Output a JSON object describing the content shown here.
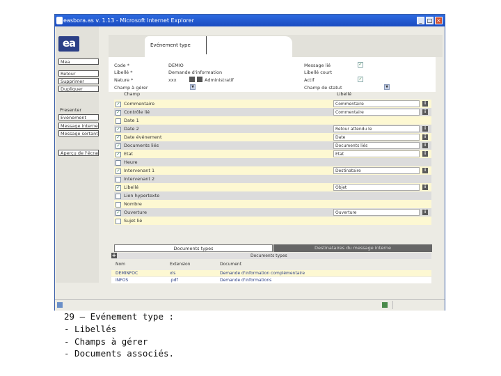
{
  "window": {
    "title": "easbora.as v. 1.13 - Microsoft Internet Explorer"
  },
  "sidebar": {
    "buttons_top": [
      "Mea",
      "Retour",
      "Supprimer",
      "Dupliquer"
    ],
    "section_label": "Presenter",
    "buttons_mid": [
      "Evénement",
      "Message interne",
      "Message sortant"
    ],
    "button_bottom": "Aperçu de l'écran"
  },
  "tab": {
    "label": "Evénement type"
  },
  "form": {
    "code_label": "Code *",
    "code_value": "DEMIO",
    "libelle_label": "Libellé *",
    "libelle_value": "Demande d'information",
    "nature_label": "Nature *",
    "nature_value": "xxx",
    "nature_extra": "Administratif",
    "champ_label": "Champ à gérer",
    "message_label": "Message lié",
    "message_checked": true,
    "libelle_court_label": "Libellé court",
    "actif_label": "Actif",
    "actif_checked": true,
    "champ_statut_label": "Champ de statut"
  },
  "grid": {
    "col_champ": "Champ",
    "col_libelle": "Libellé",
    "rows": [
      {
        "checked": true,
        "name": "Commentaire",
        "libelle": "Commentaire",
        "info": true
      },
      {
        "checked": true,
        "name": "Contrôle lié",
        "libelle": "Commentaire",
        "info": true
      },
      {
        "checked": false,
        "name": "Date 1",
        "libelle": "",
        "info": false
      },
      {
        "checked": true,
        "name": "Date 2",
        "libelle": "Retour attendu le",
        "info": true
      },
      {
        "checked": true,
        "name": "Date événement",
        "libelle": "Date",
        "info": true
      },
      {
        "checked": true,
        "name": "Documents liés",
        "libelle": "Documents liés",
        "info": true
      },
      {
        "checked": true,
        "name": "Etat",
        "libelle": "Etat",
        "info": true
      },
      {
        "checked": false,
        "name": "Heure",
        "libelle": "",
        "info": false
      },
      {
        "checked": true,
        "name": "Intervenant 1",
        "libelle": "Destinataire",
        "info": true
      },
      {
        "checked": false,
        "name": "Intervenant 2",
        "libelle": "",
        "info": false
      },
      {
        "checked": true,
        "name": "Libellé",
        "libelle": "Objet",
        "info": true
      },
      {
        "checked": false,
        "name": "Lien hypertexte",
        "libelle": "",
        "info": false
      },
      {
        "checked": false,
        "name": "Nombre",
        "libelle": "",
        "info": false
      },
      {
        "checked": true,
        "name": "Ouverture",
        "libelle": "Ouverture",
        "info": true
      },
      {
        "checked": false,
        "name": "Sujet lié",
        "libelle": "",
        "info": false
      }
    ]
  },
  "bottom_tabs": [
    "Documents types",
    "Destinataires du message interne"
  ],
  "doc_types": {
    "title": "Documents types",
    "headers": [
      "Nom",
      "Extension",
      "Document"
    ],
    "rows": [
      {
        "nom": "DEMINFOC",
        "ext": "xls",
        "doc": "Demande d'information complémentaire"
      },
      {
        "nom": "INFOS",
        "ext": ".pdf",
        "doc": "Demande d'informations"
      }
    ]
  },
  "caption": [
    "29 – Evénement type :",
    "- Libellés",
    "- Champs à gérer",
    "- Documents associés."
  ],
  "colors": {
    "row_yellow": "#fdf8d2",
    "row_gray": "#dcdcdc",
    "titlebar": "#1f55cf",
    "logo": "#2b3f86"
  }
}
